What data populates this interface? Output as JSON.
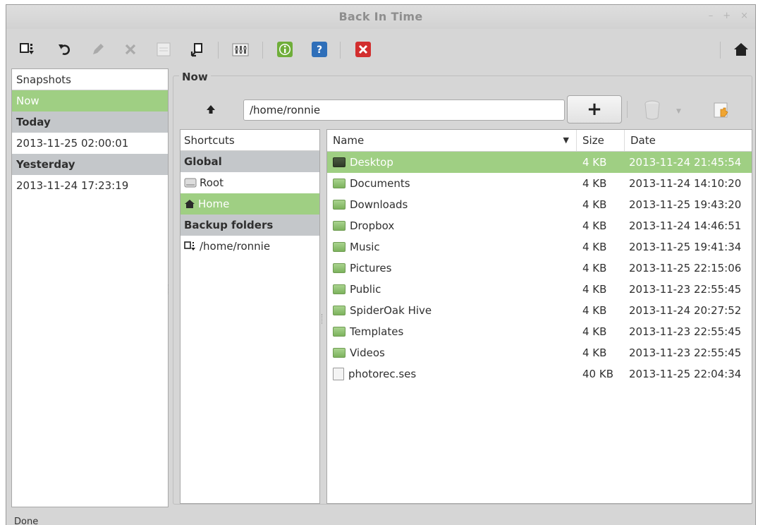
{
  "window": {
    "title": "Back In Time",
    "controls": [
      "–",
      "+",
      "×"
    ]
  },
  "toolbar": {
    "icons": [
      "take-snapshot",
      "refresh",
      "edit-snapshot",
      "remove-snapshot",
      "snapshot-name",
      "restore",
      "settings",
      "about-info",
      "help",
      "exit",
      "home"
    ]
  },
  "snapshots": {
    "header": "Snapshots",
    "now": "Now",
    "groups": [
      {
        "label": "Today",
        "items": [
          "2013-11-25 02:00:01"
        ]
      },
      {
        "label": "Yesterday",
        "items": [
          "2013-11-24 17:23:19"
        ]
      }
    ]
  },
  "main": {
    "frame_label": "Now",
    "path": "/home/ronnie",
    "add_label": "+"
  },
  "shortcuts": {
    "header": "Shortcuts",
    "global_label": "Global",
    "root_label": "Root",
    "home_label": "Home",
    "backup_label": "Backup folders",
    "backup_path": "/home/ronnie"
  },
  "files": {
    "columns": {
      "name": "Name",
      "size": "Size",
      "date": "Date"
    },
    "rows": [
      {
        "name": "Desktop",
        "size": "4 KB",
        "date": "2013-11-24 21:45:54",
        "type": "folder",
        "selected": true
      },
      {
        "name": "Documents",
        "size": "4 KB",
        "date": "2013-11-24 14:10:20",
        "type": "folder"
      },
      {
        "name": "Downloads",
        "size": "4 KB",
        "date": "2013-11-25 19:43:20",
        "type": "folder"
      },
      {
        "name": "Dropbox",
        "size": "4 KB",
        "date": "2013-11-24 14:46:51",
        "type": "folder"
      },
      {
        "name": "Music",
        "size": "4 KB",
        "date": "2013-11-25 19:41:34",
        "type": "folder"
      },
      {
        "name": "Pictures",
        "size": "4 KB",
        "date": "2013-11-25 22:15:06",
        "type": "folder"
      },
      {
        "name": "Public",
        "size": "4 KB",
        "date": "2013-11-23 22:55:45",
        "type": "folder"
      },
      {
        "name": "SpiderOak Hive",
        "size": "4 KB",
        "date": "2013-11-24 20:27:52",
        "type": "folder"
      },
      {
        "name": "Templates",
        "size": "4 KB",
        "date": "2013-11-23 22:55:45",
        "type": "folder"
      },
      {
        "name": "Videos",
        "size": "4 KB",
        "date": "2013-11-23 22:55:45",
        "type": "folder"
      },
      {
        "name": "photorec.ses",
        "size": "40 KB",
        "date": "2013-11-25 22:04:34",
        "type": "file"
      }
    ]
  },
  "status": {
    "text": "Done"
  },
  "colors": {
    "selection": "#9fcf83",
    "group": "#c4c7ca",
    "window": "#d6d6d6"
  }
}
